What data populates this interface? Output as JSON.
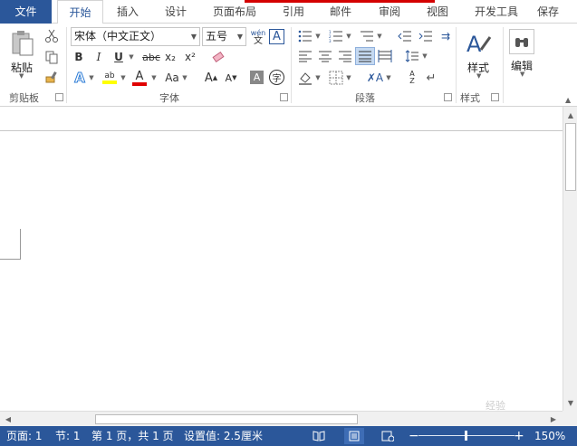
{
  "tabs": [
    {
      "label": "文件"
    },
    {
      "label": "开始"
    },
    {
      "label": "插入"
    },
    {
      "label": "设计"
    },
    {
      "label": "页面布局"
    },
    {
      "label": "引用"
    },
    {
      "label": "邮件"
    },
    {
      "label": "审阅"
    },
    {
      "label": "视图"
    },
    {
      "label": "开发工具"
    },
    {
      "label": "保存"
    }
  ],
  "ribbon": {
    "clipboard": {
      "label": "剪贴板",
      "paste": "粘贴"
    },
    "font": {
      "label": "字体",
      "font_name": "宋体（中文正文）",
      "font_size": "五号",
      "bold": "B",
      "italic": "I",
      "underline": "U",
      "strike": "abc",
      "subscript": "x₂",
      "superscript": "x²",
      "wen": "wén",
      "wen2": "文",
      "A_box": "A",
      "grow": "A",
      "shrink": "A",
      "case": "Aa",
      "char": "字"
    },
    "paragraph": {
      "label": "段落"
    },
    "styles": {
      "label": "样式",
      "button": "样式"
    },
    "editing": {
      "button": "编辑"
    }
  },
  "status": {
    "page": "页面: 1",
    "section": "节: 1",
    "pages": "第 1 页，共 1 页",
    "setting": "设置值: 2.5厘米",
    "zoom": "150%",
    "zoom_level": 0.5
  },
  "watermark": "经验",
  "colors": {
    "brand": "#2b579a",
    "highlight": "#ffff00",
    "font_color": "#e00000",
    "redline": "#d40000"
  }
}
